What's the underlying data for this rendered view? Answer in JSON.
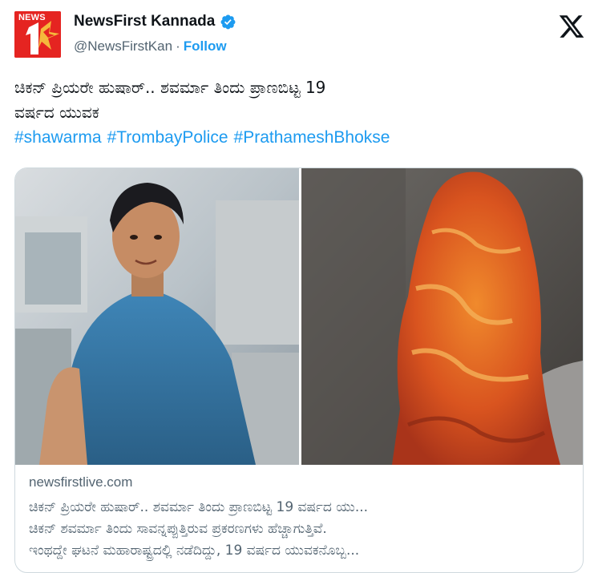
{
  "account": {
    "avatar_text": "NEWS",
    "display_name": "NewsFirst Kannada",
    "handle": "@NewsFirstKan",
    "separator": "·",
    "follow_label": "Follow"
  },
  "icons": {
    "verified": "verified-badge-icon",
    "platform": "x-logo-icon"
  },
  "colors": {
    "accent": "#1d9bf0",
    "avatar_red": "#e52421",
    "text_primary": "#0f1419",
    "text_secondary": "#536471"
  },
  "tweet": {
    "line1": "ಚಿಕನ್ ಪ್ರಿಯರೇ ಹುಷಾರ್.. ಶವರ್ಮಾ ತಿಂದು ಪ್ರಾಣಬಿಟ್ಟ 19",
    "line2": "ವರ್ಷದ ಯುವಕ",
    "hashtags": [
      "#shawarma",
      "#TrombayPolice",
      "#PrathameshBhokse"
    ]
  },
  "card": {
    "domain": "newsfirstlive.com",
    "title": "ಚಿಕನ್ ಪ್ರಿಯರೇ ಹುಷಾರ್.. ಶವರ್ಮಾ ತಿಂದು ಪ್ರಾಣಬಿಟ್ಟ 19 ವರ್ಷದ ಯು...",
    "desc_line1": "ಚಿಕನ್ ಶವರ್ಮಾ ತಿಂದು ಸಾವನ್ನಪ್ಪುತ್ತಿರುವ ಪ್ರಕರಣಗಳು ಹೆಚ್ಚಾಗುತ್ತಿವೆ.",
    "desc_line2": "ಇಂಥದ್ದೇ ಘಟನೆ ಮಹಾರಾಷ್ಟ್ರದಲ್ಲಿ ನಡೆದಿದ್ದು, 19 ವರ್ಷದ ಯುವಕನೊಬ್ಬ..."
  }
}
